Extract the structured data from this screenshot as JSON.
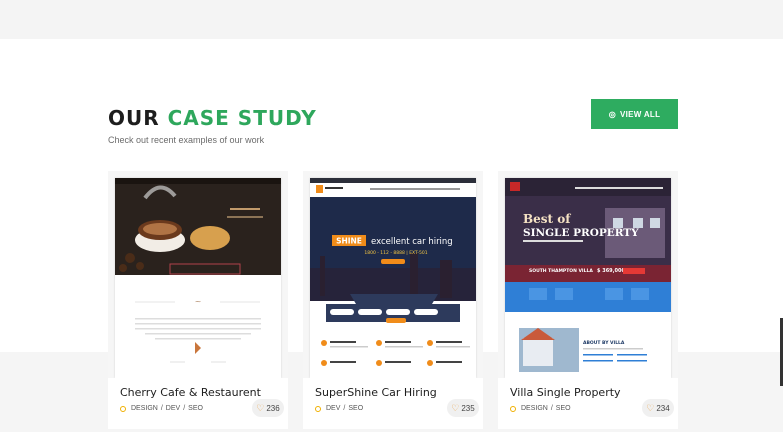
{
  "section": {
    "heading_part1": "OUR",
    "heading_part2": "CASE STUDY",
    "subheading": "Check out recent examples of our work",
    "view_all_label": "VIEW ALL",
    "view_all_icon": "eye-icon"
  },
  "colors": {
    "accent": "#2ea75c",
    "button": "#2eac60",
    "tag_dot": "#f0b000",
    "heart": "#e8a44a"
  },
  "cards": [
    {
      "title": "Cherry Cafe & Restaurent",
      "tags": [
        "DESIGN",
        "DEV",
        "SEO"
      ],
      "likes": "236"
    },
    {
      "title": "SuperShine Car Hiring",
      "tags": [
        "DEV",
        "SEO"
      ],
      "likes": "235"
    },
    {
      "title": "Villa Single Property",
      "tags": [
        "DESIGN",
        "SEO"
      ],
      "likes": "234"
    }
  ],
  "thumbs": {
    "car": {
      "badge": "SHINE",
      "headline": "excellent car hiring",
      "phone": "1800 - 112 - 8888 | EXT-501"
    },
    "villa": {
      "headline_1": "Best of",
      "headline_2": "SINGLE PROPERTY",
      "name": "SOUTH THAMPTON VILLA",
      "price": "$ 369,000",
      "about": "ABOUT BY VILLA"
    }
  }
}
